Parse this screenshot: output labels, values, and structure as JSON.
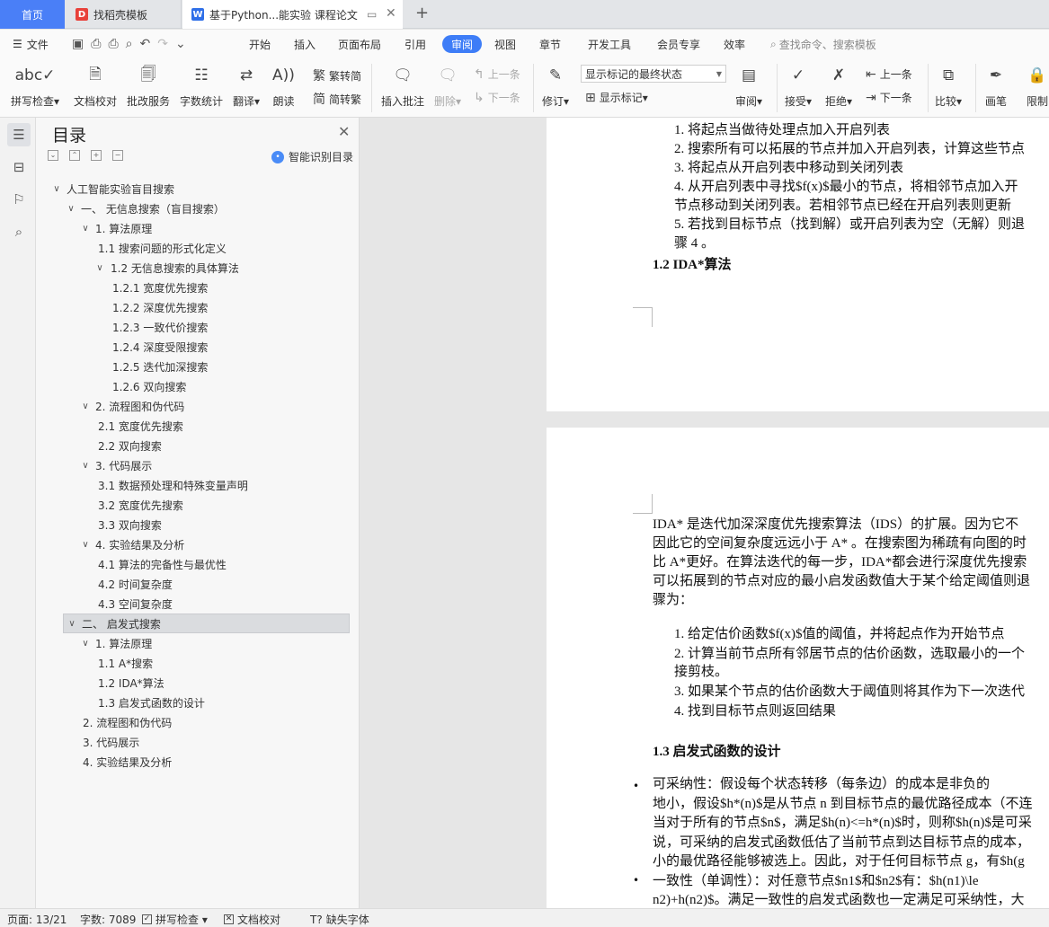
{
  "tabs": {
    "home": "首页",
    "tab2": "找稻壳模板",
    "tab3": "基于Python...能实验 课程论文"
  },
  "menu": {
    "file": "文件",
    "items": [
      "开始",
      "插入",
      "页面布局",
      "引用",
      "审阅",
      "视图",
      "章节",
      "开发工具",
      "会员专享",
      "效率"
    ],
    "active": "审阅",
    "search": "查找命令、搜索模板"
  },
  "ribbon": {
    "spell": "拼写检查",
    "doc_check": "文档校对",
    "batch": "批改服务",
    "wordcount": "字数统计",
    "translate": "翻译",
    "read": "朗读",
    "trad": "繁转简",
    "simp": "简转繁",
    "insert_comment": "插入批注",
    "delete": "删除",
    "prev": "上一条",
    "next": "下一条",
    "revise": "修订",
    "markup_state": "显示标记的最终状态",
    "show_markup": "显示标记",
    "review": "审阅",
    "accept": "接受",
    "reject": "拒绝",
    "prev2": "上一条",
    "next2": "下一条",
    "compare": "比较",
    "pen": "画笔",
    "restrict": "限制"
  },
  "toc": {
    "title": "目录",
    "smart": "智能识别目录",
    "items": [
      {
        "text": "人工智能实验盲目搜索",
        "chev": true
      },
      {
        "text": "一、  无信息搜索（盲目搜索）",
        "chev": true
      },
      {
        "text": "1. 算法原理",
        "chev": true
      },
      {
        "text": "1.1  搜索问题的形式化定义",
        "chev": false
      },
      {
        "text": "1.2  无信息搜索的具体算法",
        "chev": true
      },
      {
        "text": "1.2.1  宽度优先搜索",
        "chev": false
      },
      {
        "text": "1.2.2  深度优先搜索",
        "chev": false
      },
      {
        "text": "1.2.3  一致代价搜索",
        "chev": false
      },
      {
        "text": "1.2.4  深度受限搜索",
        "chev": false
      },
      {
        "text": "1.2.5  迭代加深搜索",
        "chev": false
      },
      {
        "text": "1.2.6  双向搜索",
        "chev": false
      },
      {
        "text": "2. 流程图和伪代码",
        "chev": true
      },
      {
        "text": "2.1  宽度优先搜索",
        "chev": false
      },
      {
        "text": "2.2  双向搜索",
        "chev": false
      },
      {
        "text": "3. 代码展示",
        "chev": true
      },
      {
        "text": "3.1  数据预处理和特殊变量声明",
        "chev": false
      },
      {
        "text": "3.2  宽度优先搜索",
        "chev": false
      },
      {
        "text": "3.3  双向搜索",
        "chev": false
      },
      {
        "text": "4. 实验结果及分析",
        "chev": true
      },
      {
        "text": "4.1  算法的完备性与最优性",
        "chev": false
      },
      {
        "text": "4.2  时间复杂度",
        "chev": false
      },
      {
        "text": "4.3  空间复杂度",
        "chev": false
      },
      {
        "text": "二、  启发式搜索",
        "chev": true
      },
      {
        "text": "1. 算法原理",
        "chev": true
      },
      {
        "text": "1.1 A*搜索",
        "chev": false
      },
      {
        "text": "1.2 IDA*算法",
        "chev": false
      },
      {
        "text": "1.3  启发式函数的设计",
        "chev": false
      },
      {
        "text": "2. 流程图和伪代码",
        "chev": false
      },
      {
        "text": "3. 代码展示",
        "chev": false
      },
      {
        "text": "4. 实验结果及分析",
        "chev": false
      }
    ]
  },
  "doc": {
    "page1": [
      "1.   将起点当做待处理点加入开启列表",
      "2.   搜索所有可以拓展的节点并加入开启列表，计算这些节点",
      "3.   将起点从开启列表中移动到关闭列表",
      "4.   从开启列表中寻找$f(x)$最小的节点，将相邻节点加入开",
      "      节点移动到关闭列表。若相邻节点已经在开启列表则更新",
      "5.   若找到目标节点（找到解）或开启列表为空（无解）则退",
      "      骤 4 。"
    ],
    "h12": "1.2 IDA*算法",
    "para1": [
      "IDA* 是迭代加深深度优先搜索算法（IDS）的扩展。因为它不",
      "因此它的空间复杂度远远小于 A* 。在搜索图为稀疏有向图的时",
      "比 A*更好。在算法迭代的每一步，IDA*都会进行深度优先搜索",
      "可以拓展到的节点对应的最小启发函数值大于某个给定阈值则退",
      "骤为："
    ],
    "list2": [
      "1.   给定估价函数$f(x)$值的阈值，并将起点作为开始节点",
      "2.   计算当前节点所有邻居节点的估价函数，选取最小的一个",
      "      接剪枝。",
      "3.   如果某个节点的估价函数大于阈值则将其作为下一次迭代",
      "4.   找到目标节点则返回结果"
    ],
    "h13": "1.3  启发式函数的设计",
    "para2": [
      "        可采纳性：假设每个状态转移（每条边）的成本是非负的",
      "地小，假设$h*(n)$是从节点 n 到目标节点的最优路径成本（不连",
      "当对于所有的节点$n$，满足$h(n)<=h*(n)$时，则称$h(n)$是可采",
      "说，可采纳的启发式函数低估了当前节点到达目标节点的成本，",
      "小的最优路径能够被选上。因此，对于任何目标节点 g，有$h(g",
      "        一致性（单调性）：对任意节点$n1$和$n2$有：$h(n1)\\le",
      "n2)+h(n2)$。满足一致性的启发式函数也一定满足可采纳性，大"
    ]
  },
  "status": {
    "page": "页面: 13/21",
    "words": "字数: 7089",
    "spell": "拼写检查",
    "doc_check": "文档校对",
    "missing_font": "缺失字体"
  }
}
